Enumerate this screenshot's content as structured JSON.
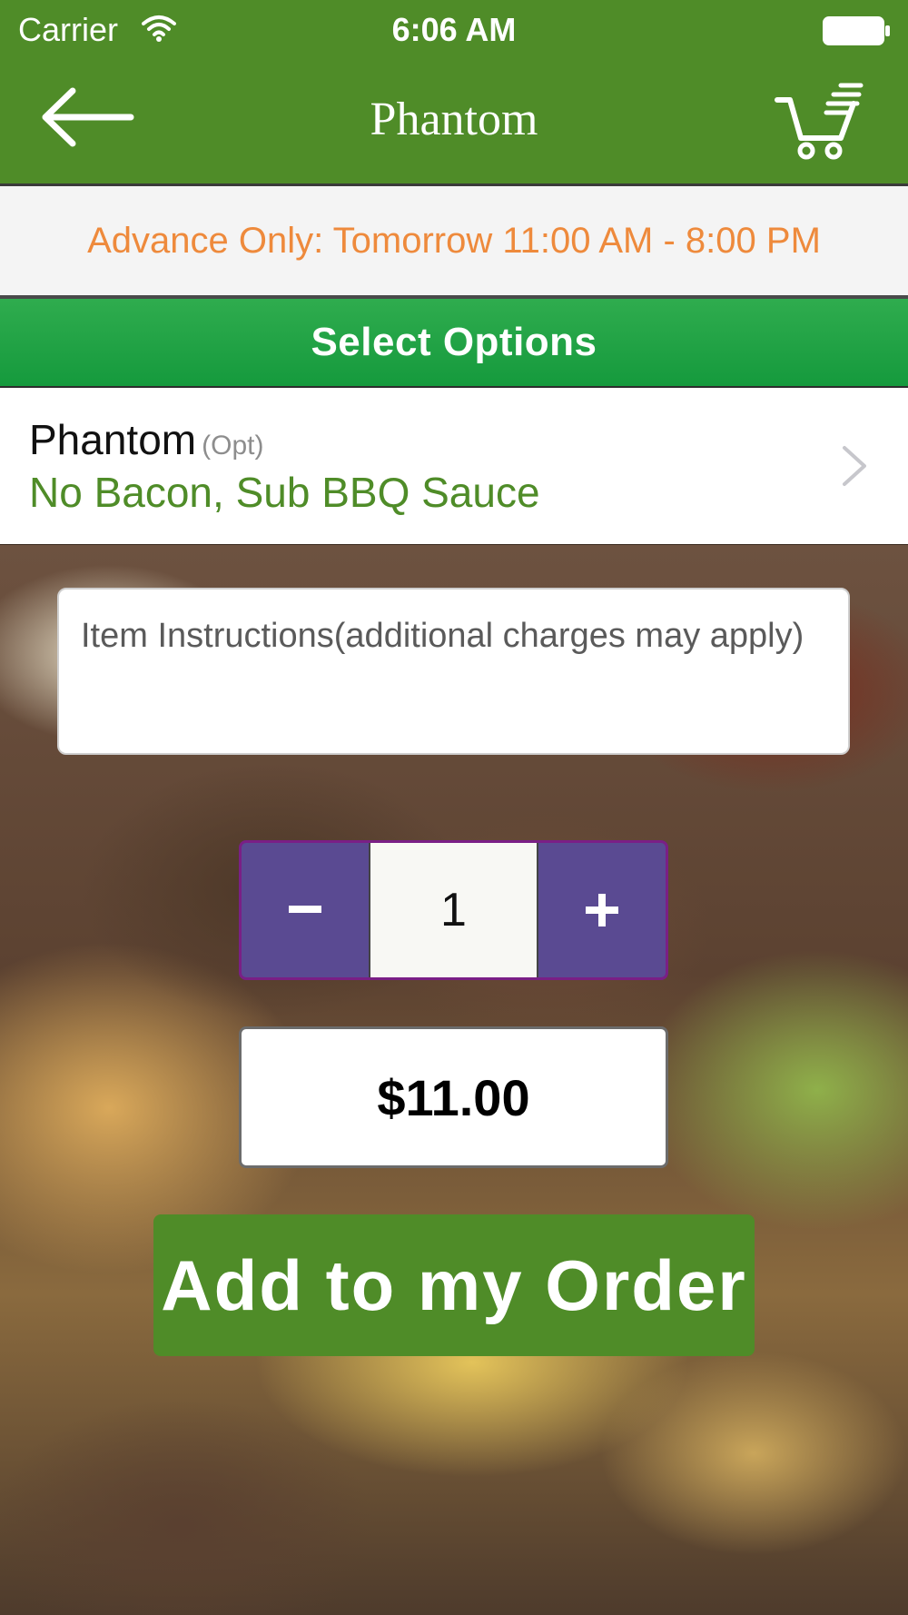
{
  "status_bar": {
    "carrier": "Carrier",
    "time": "6:06 AM"
  },
  "nav": {
    "title": "Phantom",
    "back_icon": "arrow-left-icon",
    "cart_icon": "cart-icon"
  },
  "banner": {
    "text": "Advance Only: Tomorrow 11:00 AM - 8:00 PM"
  },
  "options": {
    "header": "Select Options",
    "items": [
      {
        "name": "Phantom",
        "tag": "(Opt)",
        "value": "No Bacon, Sub BBQ Sauce"
      }
    ]
  },
  "instructions": {
    "placeholder": "Item Instructions(additional charges may apply)"
  },
  "quantity": {
    "value": "1",
    "minus": "−",
    "plus": "+"
  },
  "price": "$11.00",
  "add_button": "Add to my Order",
  "colors": {
    "brand_green": "#4f8c28",
    "banner_orange": "#ee8a3c",
    "stepper_purple": "#5a4a92"
  }
}
